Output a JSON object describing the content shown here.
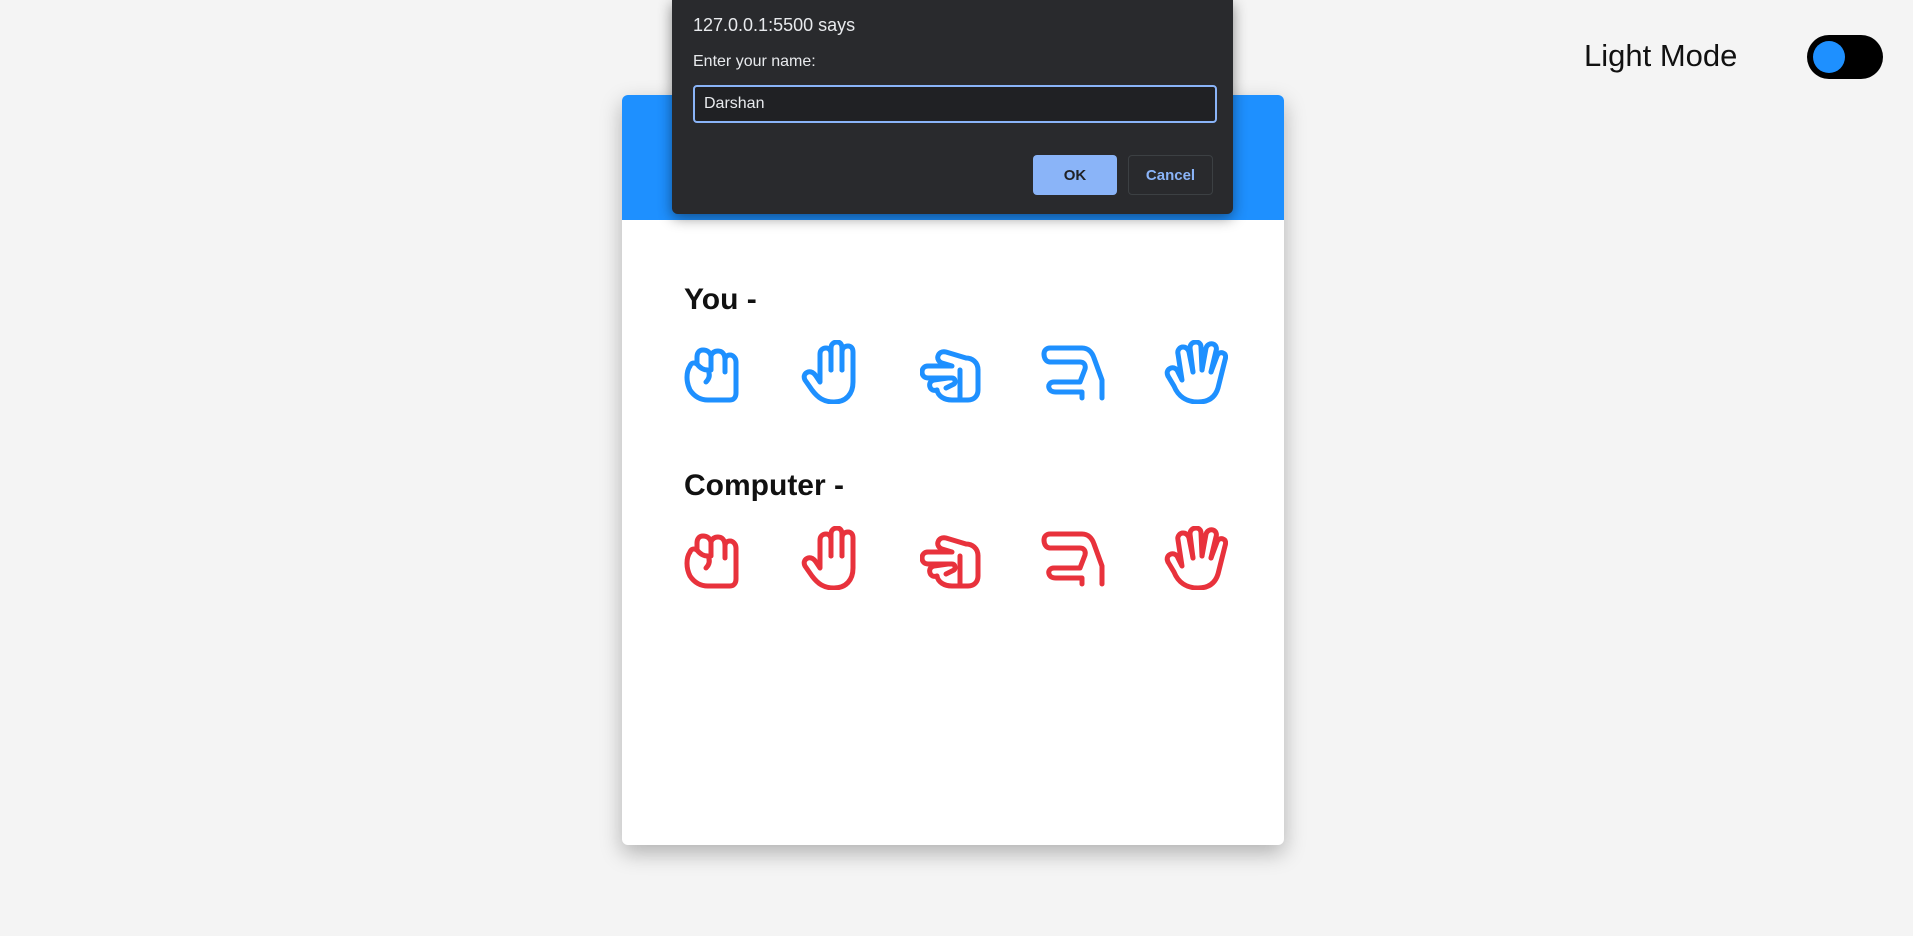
{
  "theme": {
    "label": "Light Mode",
    "toggle_state": "off",
    "knob_color": "#1e90ff"
  },
  "game": {
    "header_color": "#1e90ff",
    "you": {
      "title": "You -",
      "color": "#1e90ff",
      "choices": [
        "rock-hand-icon",
        "paper-hand-icon",
        "scissors-hand-icon",
        "lizard-hand-icon",
        "spock-hand-icon"
      ]
    },
    "computer": {
      "title": "Computer -",
      "color": "#e8323c",
      "choices": [
        "rock-hand-icon",
        "paper-hand-icon",
        "scissors-hand-icon",
        "lizard-hand-icon",
        "spock-hand-icon"
      ]
    }
  },
  "dialog": {
    "origin": "127.0.0.1:5500 says",
    "message": "Enter your name:",
    "input_value": "Darshan",
    "ok_label": "OK",
    "cancel_label": "Cancel"
  }
}
